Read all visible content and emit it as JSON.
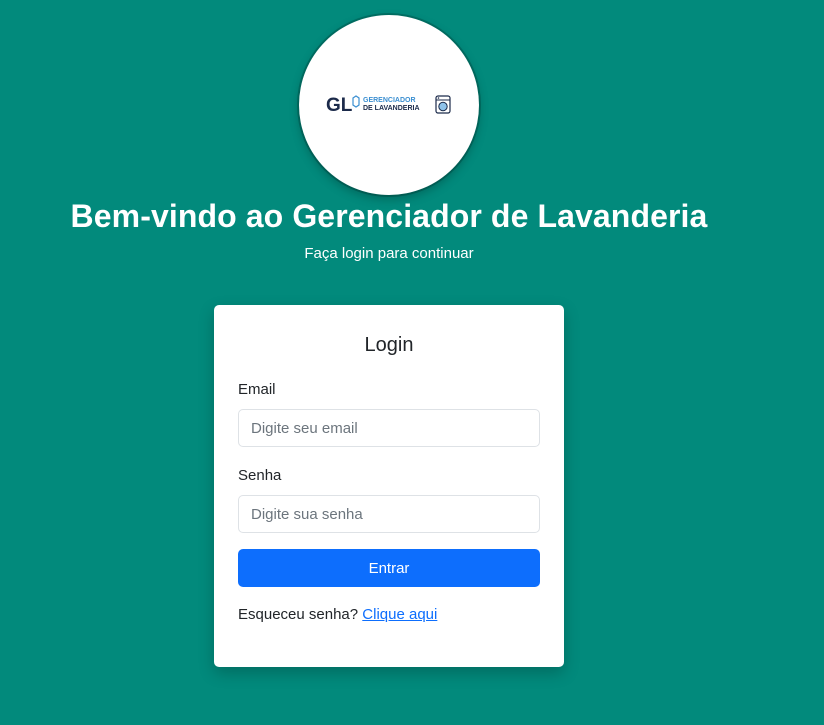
{
  "logo": {
    "monogram": "GL",
    "line1": "GERENCIADOR",
    "line2": "DE LAVANDERIA",
    "colors": {
      "navy": "#1b2a4a",
      "blue": "#3b8fd1",
      "light_blue": "#8fc3ea"
    }
  },
  "welcome": {
    "title": "Bem-vindo ao Gerenciador de Lavanderia",
    "subtitle": "Faça login para continuar"
  },
  "login_card": {
    "title": "Login",
    "email_label": "Email",
    "email_placeholder": "Digite seu email",
    "email_value": "",
    "password_label": "Senha",
    "password_placeholder": "Digite sua senha",
    "password_value": "",
    "submit_label": "Entrar",
    "forgot_text": "Esqueceu senha?",
    "forgot_link": "Clique aqui"
  },
  "colors": {
    "background": "#028a7c",
    "card": "#ffffff",
    "primary_button": "#0d6efd",
    "link": "#0d6efd",
    "text": "#212529"
  }
}
